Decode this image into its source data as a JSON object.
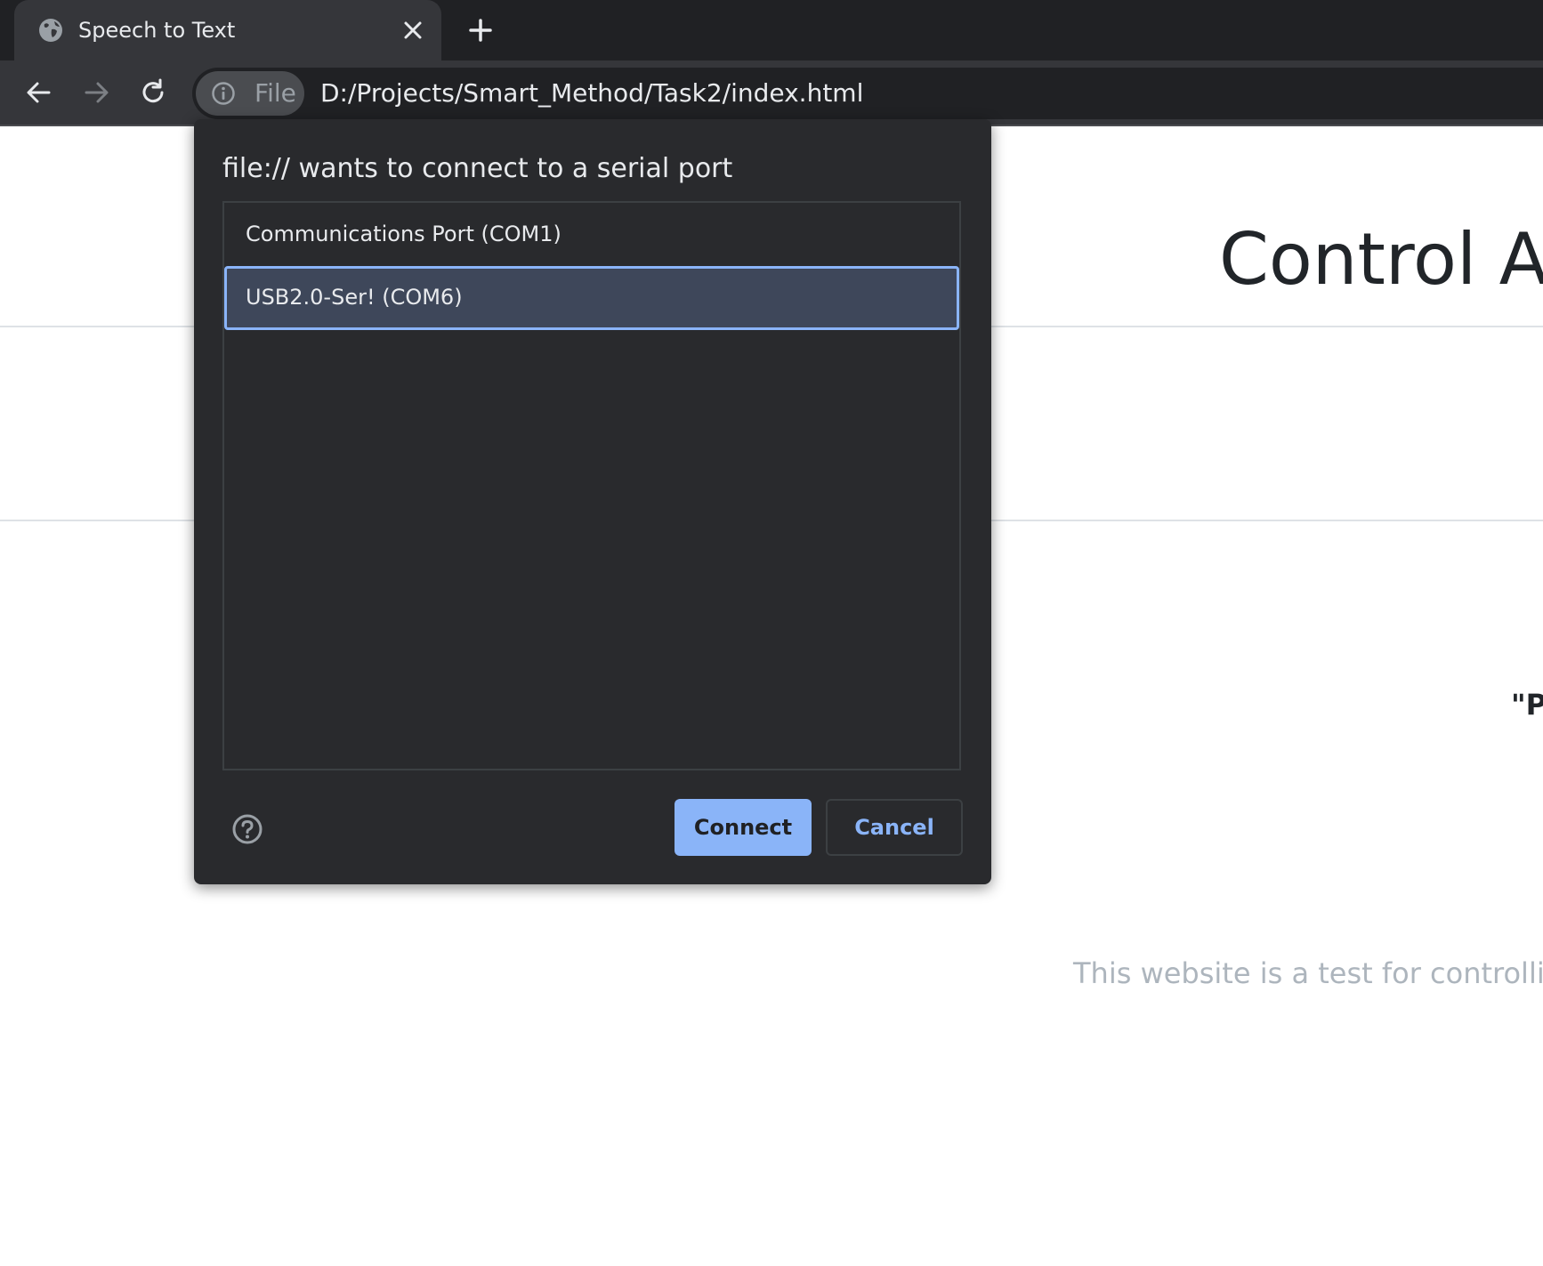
{
  "browser": {
    "tab": {
      "title": "Speech to Text",
      "favicon": "globe-icon"
    },
    "new_tab_icon": "plus-icon",
    "toolbar": {
      "back_icon": "arrow-left-icon",
      "forward_icon": "arrow-right-icon",
      "reload_icon": "reload-icon"
    },
    "omnibox": {
      "chip_icon": "info-icon",
      "chip_label": "File",
      "url": "D:/Projects/Smart_Method/Task2/index.html"
    }
  },
  "page": {
    "heading": "Control Ar",
    "quote": "\"P",
    "footer": "This website is a test for controlling A"
  },
  "dialog": {
    "title": "file:// wants to connect to a serial port",
    "ports": [
      {
        "label": "Communications Port (COM1)",
        "selected": false
      },
      {
        "label": "USB2.0-Ser! (COM6)",
        "selected": true
      }
    ],
    "help_icon": "help-circle-icon",
    "connect_label": "Connect",
    "cancel_label": "Cancel"
  },
  "colors": {
    "tabstrip_bg": "#202124",
    "toolbar_bg": "#35363a",
    "dialog_bg": "#292a2d",
    "accent": "#8ab4f8",
    "selected_row_bg": "#3e475a"
  }
}
